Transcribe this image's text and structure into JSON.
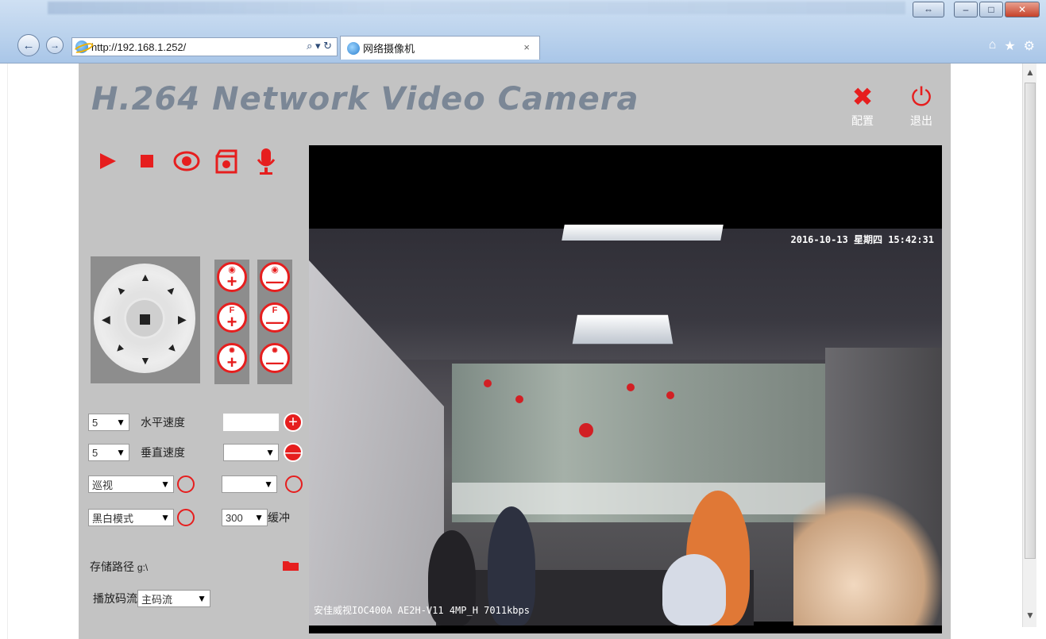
{
  "browser": {
    "url": "http://192.168.1.252/",
    "tab_title": "网络摄像机",
    "tab_close": "×"
  },
  "app": {
    "brand": "H.264 Network Video Camera",
    "config_label": "配置",
    "exit_label": "退出"
  },
  "toolbar_icons": [
    "play-icon",
    "stop-icon",
    "snapshot-icon",
    "record-icon",
    "mic-icon"
  ],
  "lens_controls": {
    "zoom": "zoom",
    "focus": "F",
    "iris": "iris"
  },
  "controls": {
    "h_speed_value": "5",
    "h_speed_label": "水平速度",
    "v_speed_value": "5",
    "v_speed_label": "垂直速度",
    "cruise_value": "巡视",
    "mode_value": "黑白模式",
    "buffer_value": "300",
    "buffer_label": "缓冲",
    "save_path_label": "存储路径",
    "save_path_value": "g:\\",
    "stream_label": "播放码流",
    "stream_value": "主码流"
  },
  "video": {
    "osd_time": "2016-10-13 星期四 15:42:31",
    "osd_name": "安佳威视IOC400A AE2H-V11 4MP_H 7011kbps"
  },
  "colors": {
    "accent": "#e61e1e",
    "panel": "#c3c3c3"
  }
}
